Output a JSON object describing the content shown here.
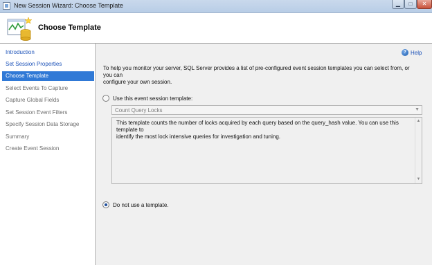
{
  "window": {
    "title": "New Session Wizard: Choose Template",
    "controls": {
      "minimize": "▁",
      "maximize": "□",
      "close": "✕"
    }
  },
  "header": {
    "title": "Choose Template",
    "icon": "wizard-chart-cylinder-icon"
  },
  "sidebar": {
    "items": [
      {
        "label": "Introduction",
        "state": "link"
      },
      {
        "label": "Set Session Properties",
        "state": "link"
      },
      {
        "label": "Choose Template",
        "state": "selected"
      },
      {
        "label": "Select Events To Capture",
        "state": "disabled"
      },
      {
        "label": "Capture Global Fields",
        "state": "disabled"
      },
      {
        "label": "Set Session Event Filters",
        "state": "disabled"
      },
      {
        "label": "Specify Session Data Storage",
        "state": "disabled"
      },
      {
        "label": "Summary",
        "state": "disabled"
      },
      {
        "label": "Create Event Session",
        "state": "disabled"
      }
    ]
  },
  "main": {
    "help_label": "Help",
    "help_icon": "help-icon",
    "intro_line1": "To help you monitor your server, SQL Server provides a list of pre-configured event session templates you can select from, or you can",
    "intro_line2": "configure your own session.",
    "use_template_label": "Use this event session template:",
    "use_template_checked": false,
    "template_combo_value": "Count Query Locks",
    "description_line1": "This template counts the number of locks acquired by each query based on the query_hash value. You can use this template to",
    "description_line2": "identify the most lock intensive queries for investigation and tuning.",
    "no_template_label": "Do not use a template.",
    "no_template_checked": true
  },
  "colors": {
    "selection": "#3079d6",
    "link": "#1b51b8",
    "disabled_text": "#6d6d6d",
    "panel_bg": "#f0f0f0"
  }
}
